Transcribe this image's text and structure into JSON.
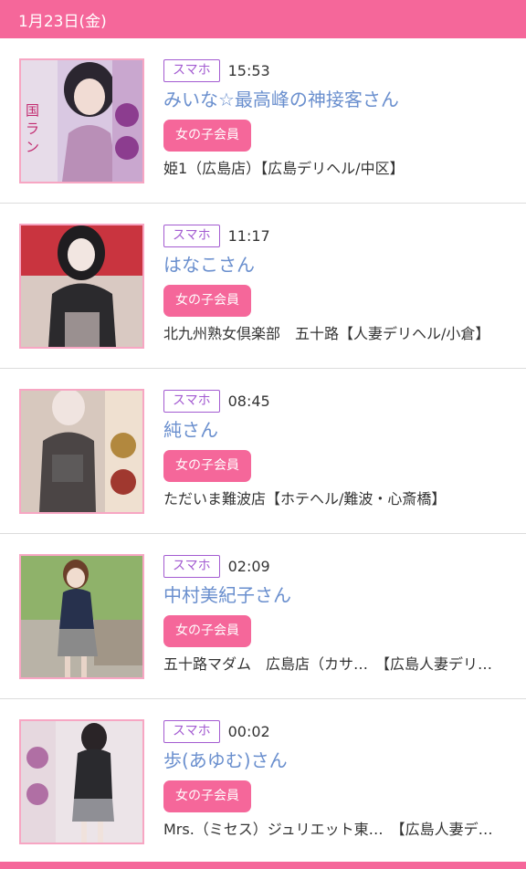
{
  "header": {
    "date": "1月23日(金)"
  },
  "entries": [
    {
      "device": "スマホ",
      "time": "15:53",
      "name": "みいな☆最高峰の神接客さん",
      "member_label": "女の子会員",
      "shop": "姫1（広島店）【広島デリヘル/中区】",
      "thumb_colors": [
        "#d9c8e2",
        "#b98fb7",
        "#efe4ee"
      ]
    },
    {
      "device": "スマホ",
      "time": "11:17",
      "name": "はなこさん",
      "member_label": "女の子会員",
      "shop": "北九州熟女倶楽部　五十路【人妻デリヘル/小倉】",
      "thumb_colors": [
        "#c9343f",
        "#2b2a2d",
        "#d9c9c2"
      ]
    },
    {
      "device": "スマホ",
      "time": "08:45",
      "name": "純さん",
      "member_label": "女の子会員",
      "shop": "ただいま難波店【ホテヘル/難波・心斎橋】",
      "thumb_colors": [
        "#d7c8be",
        "#4b4545",
        "#b2883e"
      ]
    },
    {
      "device": "スマホ",
      "time": "02:09",
      "name": "中村美紀子さん",
      "member_label": "女の子会員",
      "shop": "五十路マダム　広島店（カサ…　【広島人妻デリ…",
      "thumb_colors": [
        "#6e9b4c",
        "#27314d",
        "#b9b3a7"
      ]
    },
    {
      "device": "スマホ",
      "time": "00:02",
      "name": "歩(あゆむ)さん",
      "member_label": "女の子会員",
      "shop": "Mrs.（ミセス）ジュリエット東…　【広島人妻デ…",
      "thumb_colors": [
        "#e6d8df",
        "#2a2a2e",
        "#b06fa4"
      ]
    }
  ],
  "colors": {
    "accent_pink": "#f5679a",
    "name_blue": "#6a8fce",
    "badge_purple": "#a35bd1"
  }
}
